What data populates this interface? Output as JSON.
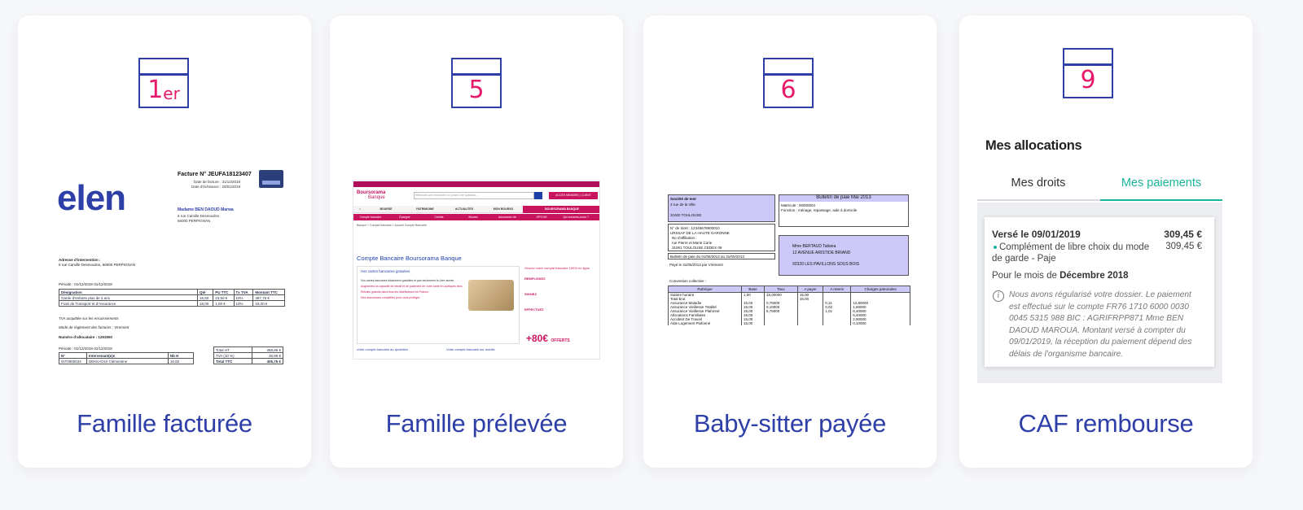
{
  "cards": [
    {
      "day": "1",
      "day_suffix": "er",
      "caption": "Famille facturée",
      "invoice": {
        "logo": "elen",
        "title": "Facture N° JEUFA18123407",
        "date_facture": "Date de facture : 31/12/2018",
        "date_echeance": "Date d'échéance : 20/01/2019",
        "client_name": "Madame BEN DAOUD Marwa",
        "client_addr1": "6 rue Camille Desmoulins",
        "client_addr2": "66000 PERPIGNAN",
        "intervention_label": "Adresse d'intervention :",
        "intervention_addr": "6 rue Camille Desmoulins, 66000 PERPIGNAN",
        "periode": "Période : 01/12/2018-31/12/2018",
        "headers": [
          "Désignation",
          "Qté",
          "PU TTC",
          "Tx TVA",
          "Montant TTC"
        ],
        "rows": [
          [
            "Garde d'enfants plus de 3 ans",
            "16,50",
            "23,50 €",
            "10%",
            "387,75 €"
          ],
          [
            "Frais de Transport et d'Assurance",
            "18,00",
            "1,00 €",
            "10%",
            "18,00 €"
          ]
        ],
        "tva_note": "TVA acquittée sur les encaissements",
        "reglement": "Mode de règlement des factures : Virement",
        "allocataire": "Numéro d'allocataire : 1291900",
        "periode2": "Période : 01/12/2018-31/12/2018",
        "intervenant_headers": [
          "N°",
          "Intervenant(e)s",
          "Nb H"
        ],
        "intervenant_row": [
          "INT0900034",
          "DEKKAOUI Clémentine",
          "16,50"
        ],
        "totals": [
          [
            "Total HT",
            "368,86 €"
          ],
          [
            "TVA (10 %)",
            "36,89 €"
          ],
          [
            "Total TTC",
            "405,75 €"
          ]
        ]
      }
    },
    {
      "day": "5",
      "caption": "Famille prélevée",
      "bank": {
        "logo_line1": "Boursorama",
        "logo_line2": "Banque",
        "search_placeholder": "Effectuez une recherche ou posez une question...",
        "login": "ACCÈS MEMBRE | CLIENT",
        "nav1": [
          "BOURSE",
          "PATRIMOINE",
          "ACTUALITÉS",
          "MON BOURSO",
          "BOURSORAMA BANQUE"
        ],
        "nav2": [
          "Compte bancaire",
          "Épargne",
          "Crédits",
          "Bourse",
          "Assurance vie",
          "OPCVM",
          "Qui sommes-nous ?"
        ],
        "crumbs": "Banque  >  Compte bancaire  >  Accueil Compte Bancaire",
        "title": "Compte Bancaire Boursorama Banque",
        "box_title": "Vos cartes bancaires gratuites",
        "list": [
          "Vos cartes bancaires totalement gratuites et pas seulement la 1ère année.",
          "Augmentez la capacité de retrait et de paiement de votre carte en quelques clics.",
          "Retraits gratuits dans tous les distributeurs en France.",
          "Des assurances complètes pour vous protéger."
        ],
        "side_title": "Ouvrez votre compte bancaire 100% en ligne",
        "side_steps": [
          "REMPLISSEZ",
          "SIGNEZ",
          "EFFECTUEZ"
        ],
        "promo": "+80€",
        "promo_sub": "OFFERTS",
        "foot1": "Votre compte bancaire au quotidien",
        "foot2": "Votre compte bancaire sur mobile"
      }
    },
    {
      "day": "6",
      "caption": "Baby-sitter payée",
      "slip": {
        "company": "Société de test",
        "company_addr": "3 rue de la Ville",
        "company_city": "31000 TOULOUSE",
        "title": "Bulletin de paie Mai 2013",
        "matricule": "Matricule :  00000004",
        "fonction": "Fonction :  ménage, repassage, aide à domicile",
        "siret": "N° de Siret : 12345678900010",
        "urssaf": "URSSAF DE LA HAUTE GARONNE",
        "affiliation": "No d'affiliation :",
        "urssaf_addr": "rue Pierre et Marie Curie",
        "urssaf_city": "31061 TOULOUSE CEDEX 09",
        "period": "Bulletin de paie du 01/05/2013 au 31/05/2013",
        "paid": "Payé le 31/05/2013 par Virement",
        "employee": "Mme BERTAUD Tatiana",
        "employee_addr": "12 AVENUE ARISTIDE BRIAND",
        "employee_city": "93320 LES PAVILLONS SOUS BOIS",
        "convention": "Convention collective :",
        "headers": [
          "Rubrique",
          "Base",
          "Taux",
          "A payer",
          "A retenir",
          "Charges patronales"
        ],
        "rows": [
          [
            "Salaire horaire",
            "1,00",
            "15,00000",
            "15,00",
            "",
            ""
          ],
          [
            "Total brut",
            "",
            "",
            "15,00",
            "",
            ""
          ],
          [
            "Assurance Maladie",
            "15,00",
            "0,75000",
            "",
            "0,11",
            "12,80000"
          ],
          [
            "Assurance Vieillesse Totalité",
            "15,00",
            "0,10000",
            "",
            "0,02",
            "1,60000"
          ],
          [
            "Assurance Vieillesse Plafonné",
            "15,00",
            "6,75000",
            "",
            "1,01",
            "8,40000"
          ],
          [
            "Allocations Familiales",
            "15,00",
            "",
            "",
            "",
            "5,40000"
          ],
          [
            "Accident De Travail",
            "15,00",
            "",
            "",
            "",
            "2,90000"
          ],
          [
            "Aide Logement Plafonné",
            "15,00",
            "",
            "",
            "",
            "0,10000"
          ]
        ]
      }
    },
    {
      "day": "9",
      "caption": "CAF rembourse",
      "app": {
        "title": "Mes allocations",
        "tab_droits": "Mes droits",
        "tab_paiements": "Mes paiements",
        "verse": "Versé le 09/01/2019",
        "amount": "309,45 €",
        "desc": "Complément de libre choix du mode de garde - Paje",
        "desc_amount": "309,45 €",
        "month_label": "Pour le mois de",
        "month_value": "Décembre 2018",
        "note": "Nous avons régularisé votre dossier. Le paiement est effectué sur le compte FR76 1710 6000 0030 0045 5315 988 BIC : AGRIFRPP871 Mme BEN DAOUD MAROUA. Montant versé à compter du 09/01/2019, la réception du paiement dépend des délais de l'organisme bancaire."
      }
    }
  ],
  "colors": {
    "brand_blue": "#2e3fa8",
    "accent_pink": "#e6196b",
    "teal": "#1ab39b"
  }
}
